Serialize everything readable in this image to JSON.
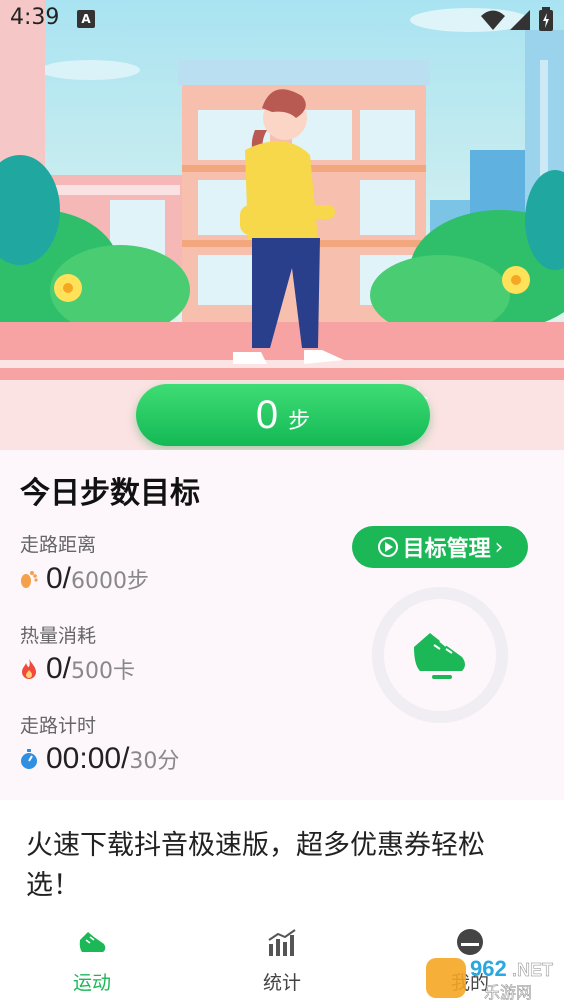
{
  "status_bar": {
    "time": "4:39",
    "notification_icon": "A"
  },
  "hero": {
    "step_value": "0",
    "step_unit": "步"
  },
  "goal_card": {
    "title": "今日步数目标",
    "goal_button_label": "目标管理",
    "metrics": [
      {
        "label": "走路距离",
        "icon": "footprints-icon",
        "value": "0/",
        "goal": "6000步"
      },
      {
        "label": "热量消耗",
        "icon": "flame-icon",
        "value": "0/",
        "goal": "500卡"
      },
      {
        "label": "走路计时",
        "icon": "stopwatch-icon",
        "value": "00:00/",
        "goal": "30分"
      }
    ],
    "ring_icon": "sneaker-icon"
  },
  "banner": {
    "text": "火速下载抖音极速版，超多优惠券轻松选！"
  },
  "tabs": [
    {
      "label": "运动",
      "icon": "sneaker-icon",
      "active": true
    },
    {
      "label": "统计",
      "icon": "bar-chart-icon",
      "active": false
    },
    {
      "label": "我的",
      "icon": "profile-icon",
      "active": false
    }
  ],
  "watermark": {
    "text_main": "962.NET",
    "text_sub": "乐游网"
  },
  "colors": {
    "accent_green": "#1cb858",
    "active_tab": "#1cb858",
    "inactive_tab": "#444444"
  }
}
